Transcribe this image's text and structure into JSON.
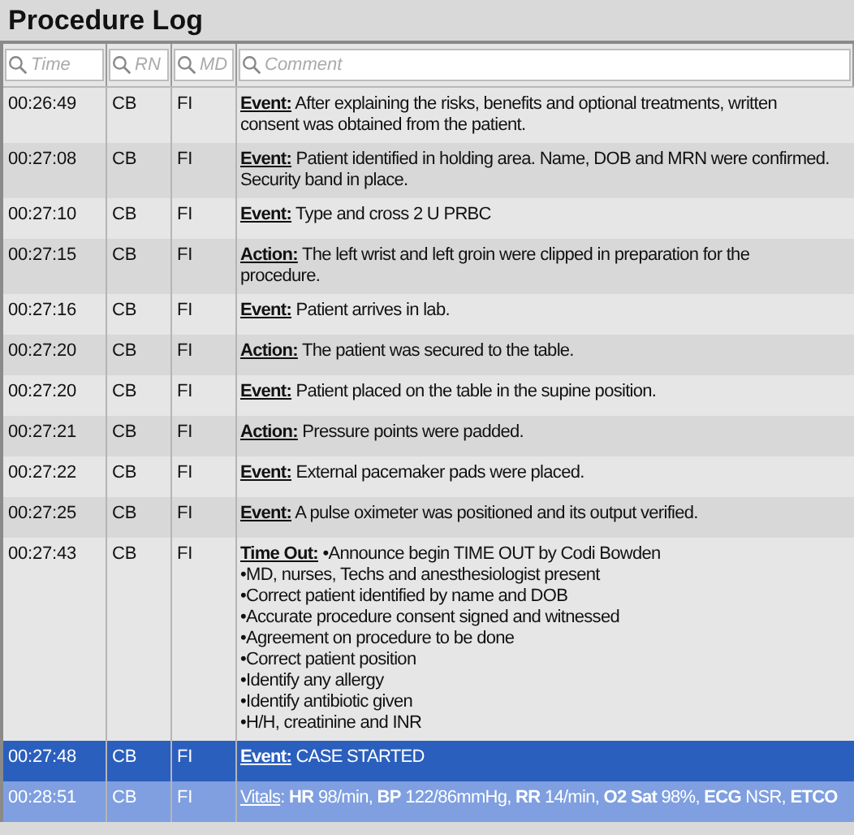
{
  "title": "Procedure Log",
  "filters": [
    {
      "placeholder": "Time"
    },
    {
      "placeholder": "RN"
    },
    {
      "placeholder": "MD"
    },
    {
      "placeholder": "Comment"
    }
  ],
  "rows": [
    {
      "time": "00:26:49",
      "rn": "CB",
      "md": "FI",
      "label": "Event:",
      "lines": [
        "After explaining the risks, benefits and optional treatments, written",
        "consent was obtained from the patient."
      ],
      "selected": false,
      "tinted": false
    },
    {
      "time": "00:27:08",
      "rn": "CB",
      "md": "FI",
      "label": "Event:",
      "lines": [
        "Patient identified in holding area. Name, DOB and MRN were confirmed.",
        "Security band in place."
      ],
      "selected": false,
      "tinted": false
    },
    {
      "time": "00:27:10",
      "rn": "CB",
      "md": "FI",
      "label": "Event:",
      "lines": [
        "Type and cross 2 U PRBC"
      ],
      "selected": false,
      "tinted": false
    },
    {
      "time": "00:27:15",
      "rn": "CB",
      "md": "FI",
      "label": "Action:",
      "lines": [
        "The left wrist and left groin were clipped in preparation for the",
        "procedure."
      ],
      "selected": false,
      "tinted": false
    },
    {
      "time": "00:27:16",
      "rn": "CB",
      "md": "FI",
      "label": "Event:",
      "lines": [
        "Patient arrives in lab."
      ],
      "selected": false,
      "tinted": false
    },
    {
      "time": "00:27:20",
      "rn": "CB",
      "md": "FI",
      "label": "Action:",
      "lines": [
        "The patient was secured to the table."
      ],
      "selected": false,
      "tinted": false
    },
    {
      "time": "00:27:20",
      "rn": "CB",
      "md": "FI",
      "label": "Event:",
      "lines": [
        "Patient placed on the table in the supine position."
      ],
      "selected": false,
      "tinted": false
    },
    {
      "time": "00:27:21",
      "rn": "CB",
      "md": "FI",
      "label": "Action:",
      "lines": [
        "Pressure points were padded."
      ],
      "selected": false,
      "tinted": false
    },
    {
      "time": "00:27:22",
      "rn": "CB",
      "md": "FI",
      "label": "Event:",
      "lines": [
        "External pacemaker pads were placed."
      ],
      "selected": false,
      "tinted": false
    },
    {
      "time": "00:27:25",
      "rn": "CB",
      "md": "FI",
      "label": "Event:",
      "lines": [
        "A pulse oximeter was positioned and its output verified."
      ],
      "selected": false,
      "tinted": false
    },
    {
      "time": "00:27:43",
      "rn": "CB",
      "md": "FI",
      "label": "Time Out:",
      "lines": [
        "•Announce begin TIME OUT by Codi Bowden",
        "•MD, nurses, Techs and anesthesiologist present",
        "•Correct patient identified by name and DOB",
        "•Accurate procedure consent signed and witnessed",
        "•Agreement on procedure to be done",
        "•Correct patient position",
        "•Identify any allergy",
        "•Identify antibiotic given",
        "•H/H, creatinine and INR"
      ],
      "selected": false,
      "tinted": false
    },
    {
      "time": "00:27:48",
      "rn": "CB",
      "md": "FI",
      "label": "Event:",
      "lines": [
        "CASE STARTED"
      ],
      "selected": true,
      "tinted": false
    },
    {
      "time": "00:28:51",
      "rn": "CB",
      "md": "FI",
      "label": "Vitals",
      "lines": [
        ": **HR** 98/min, **BP** 122/86mmHg, **RR** 14/min, **O2 Sat** 98%, **ECG** NSR, **ETCO**"
      ],
      "selected": false,
      "tinted": true
    }
  ]
}
